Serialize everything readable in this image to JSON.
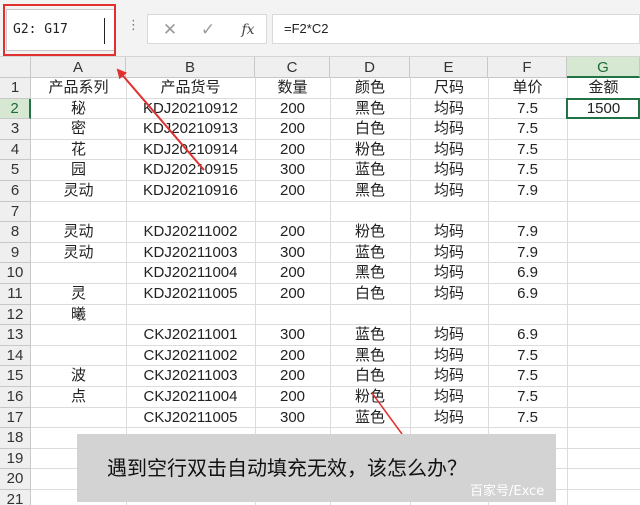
{
  "formula_bar": {
    "name_box": "G2: G17",
    "more_icon": "more-vertical-icon",
    "cancel_icon": "close-icon",
    "enter_icon": "check-icon",
    "fx_label": "fx",
    "formula": "=F2*C2"
  },
  "columns": [
    "A",
    "B",
    "C",
    "D",
    "E",
    "F",
    "G"
  ],
  "selected_column": "G",
  "rows": [
    "1",
    "2",
    "3",
    "4",
    "5",
    "6",
    "7",
    "8",
    "9",
    "10",
    "11",
    "12",
    "13",
    "14",
    "15",
    "16",
    "17",
    "18",
    "19",
    "20",
    "21"
  ],
  "selected_row": "2",
  "sheet": {
    "headers": [
      "产品系列",
      "产品货号",
      "数量",
      "颜色",
      "尺码",
      "单价",
      "金额"
    ],
    "records": [
      {
        "row": "2",
        "code": "KDJ20210912",
        "qty": "200",
        "color": "黑色",
        "size": "均码",
        "price": "7.5",
        "amount": "1500"
      },
      {
        "row": "3",
        "code": "KDJ20210913",
        "qty": "200",
        "color": "白色",
        "size": "均码",
        "price": "7.5"
      },
      {
        "row": "4",
        "code": "KDJ20210914",
        "qty": "200",
        "color": "粉色",
        "size": "均码",
        "price": "7.5"
      },
      {
        "row": "5",
        "code": "KDJ20210915",
        "qty": "300",
        "color": "蓝色",
        "size": "均码",
        "price": "7.5"
      },
      {
        "row": "6",
        "code": "KDJ20210916",
        "qty": "200",
        "color": "黑色",
        "size": "均码",
        "price": "7.9"
      },
      {
        "row": "8",
        "code": "KDJ20211002",
        "qty": "200",
        "color": "粉色",
        "size": "均码",
        "price": "7.9"
      },
      {
        "row": "9",
        "code": "KDJ20211003",
        "qty": "300",
        "color": "蓝色",
        "size": "均码",
        "price": "7.9"
      },
      {
        "row": "10",
        "code": "KDJ20211004",
        "qty": "200",
        "color": "黑色",
        "size": "均码",
        "price": "6.9"
      },
      {
        "row": "11",
        "code": "KDJ20211005",
        "qty": "200",
        "color": "白色",
        "size": "均码",
        "price": "6.9"
      },
      {
        "row": "13",
        "code": "CKJ20211001",
        "qty": "300",
        "color": "蓝色",
        "size": "均码",
        "price": "6.9"
      },
      {
        "row": "14",
        "code": "CKJ20211002",
        "qty": "200",
        "color": "黑色",
        "size": "均码",
        "price": "7.5"
      },
      {
        "row": "15",
        "code": "CKJ20211003",
        "qty": "200",
        "color": "白色",
        "size": "均码",
        "price": "7.5"
      },
      {
        "row": "16",
        "code": "CKJ20211004",
        "qty": "200",
        "color": "粉色",
        "size": "均码",
        "price": "7.5"
      },
      {
        "row": "17",
        "code": "CKJ20211005",
        "qty": "300",
        "color": "蓝色",
        "size": "均码",
        "price": "7.5"
      }
    ],
    "series_labels": [
      {
        "rows": "2",
        "text": "秘"
      },
      {
        "rows": "3",
        "text": "密"
      },
      {
        "rows": "4",
        "text": "花"
      },
      {
        "rows": "5",
        "text": "园"
      },
      {
        "rows": "6",
        "text": "灵动"
      },
      {
        "rows": "8",
        "text": "灵动"
      },
      {
        "rows": "9",
        "text": "灵动"
      },
      {
        "rows": "11",
        "text": "灵"
      },
      {
        "rows": "12",
        "text": "曦"
      },
      {
        "rows": "15",
        "text": "波"
      },
      {
        "rows": "16",
        "text": "点"
      }
    ]
  },
  "caption": "遇到空行双击自动填充无效，该怎么办？",
  "watermark": "百家号/Exce",
  "colors": {
    "selection_green": "#217346",
    "annotation_red": "#e03030",
    "caption_bg": "#d3d3d3"
  }
}
